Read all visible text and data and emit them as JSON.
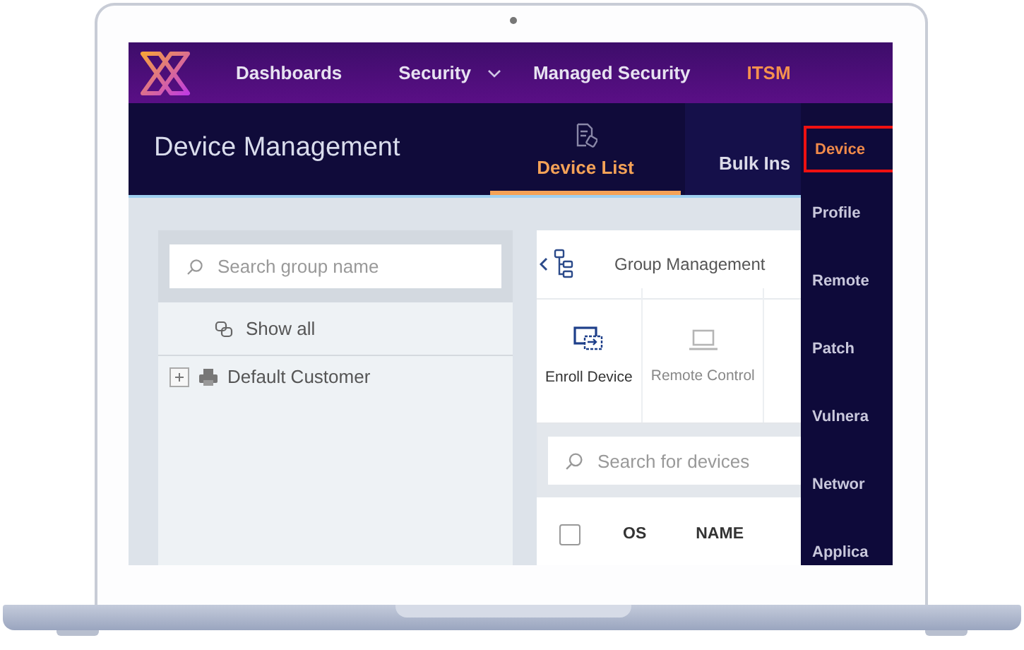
{
  "nav": {
    "items": [
      {
        "label": "Dashboards",
        "selected": false,
        "dropdown": false
      },
      {
        "label": "Security",
        "selected": false,
        "dropdown": true
      },
      {
        "label": "Managed Security",
        "selected": false,
        "dropdown": false
      },
      {
        "label": "ITSM",
        "selected": true,
        "dropdown": false
      }
    ]
  },
  "header": {
    "title": "Device Management",
    "tabs": [
      {
        "label": "Device List",
        "selected": true
      },
      {
        "label": "Bulk Ins",
        "selected": false
      }
    ]
  },
  "menu": {
    "items": [
      {
        "label": "Device",
        "selected": true
      },
      {
        "label": "Profile",
        "selected": false
      },
      {
        "label": "Remote",
        "selected": false
      },
      {
        "label": "Patch",
        "selected": false
      },
      {
        "label": "Vulnera",
        "selected": false
      },
      {
        "label": "Networ",
        "selected": false
      },
      {
        "label": "Applica",
        "selected": false
      }
    ]
  },
  "groups": {
    "search": {
      "placeholder": "Search group name"
    },
    "show_all": "Show all",
    "tree": [
      {
        "label": "Default Customer",
        "expanded": false
      }
    ]
  },
  "devices": {
    "group_button": "Group Management",
    "actions": [
      {
        "label": "Enroll Device",
        "disabled": false
      },
      {
        "label": "Remote Control",
        "disabled": true
      }
    ],
    "search": {
      "placeholder": "Search for devices"
    },
    "select_all": {
      "checked": false
    },
    "columns": [
      "OS",
      "NAME"
    ]
  }
}
